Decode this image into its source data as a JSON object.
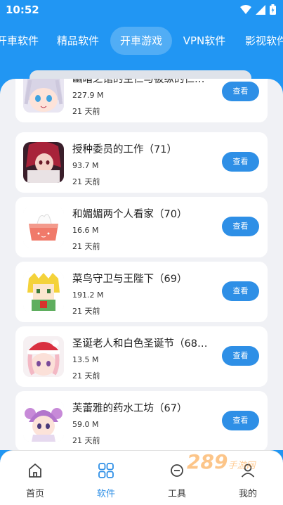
{
  "status": {
    "time": "10:52"
  },
  "tabs": [
    {
      "label": "开車软件"
    },
    {
      "label": "精品软件"
    },
    {
      "label": "开車游戏"
    },
    {
      "label": "VPN软件"
    },
    {
      "label": "影视软件"
    }
  ],
  "items": [
    {
      "title": "幽暗之馆的主仁与被纵的仁…",
      "size": "227.9 M",
      "date": "21 天前",
      "button": "查看"
    },
    {
      "title": "授种委员的工作（71）",
      "size": "93.7 M",
      "date": "21 天前",
      "button": "查看"
    },
    {
      "title": "和媚媚两个人看家（70）",
      "size": "16.6 M",
      "date": "21 天前",
      "button": "查看"
    },
    {
      "title": "菜鸟守卫与王陛下（69）",
      "size": "191.2 M",
      "date": "21 天前",
      "button": "查看"
    },
    {
      "title": "圣诞老人和白色圣诞节（68…",
      "size": "13.5 M",
      "date": "21 天前",
      "button": "查看"
    },
    {
      "title": "芙蕾雅的药水工坊（67）",
      "size": "59.0 M",
      "date": "21 天前",
      "button": "查看"
    }
  ],
  "nav": [
    {
      "label": "首页",
      "icon": "home-icon"
    },
    {
      "label": "软件",
      "icon": "grid-icon"
    },
    {
      "label": "工具",
      "icon": "tool-icon"
    },
    {
      "label": "我的",
      "icon": "profile-icon"
    }
  ],
  "watermark": {
    "text": "289",
    "sub": "手游网"
  },
  "colors": {
    "primary": "#2196F3",
    "button": "#2e8fe6",
    "background": "#f0f1f5"
  }
}
